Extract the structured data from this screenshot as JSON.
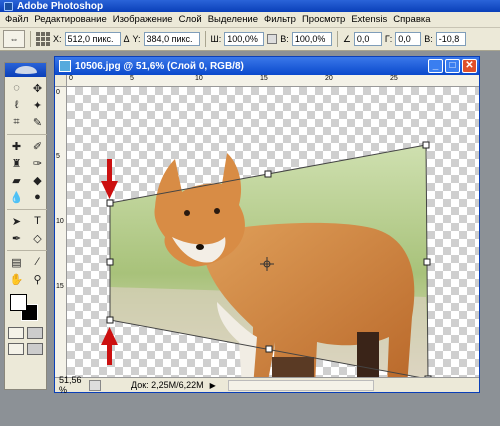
{
  "app": {
    "title": "Adobe Photoshop"
  },
  "menu": {
    "items": [
      "Файл",
      "Редактирование",
      "Изображение",
      "Слой",
      "Выделение",
      "Фильтр",
      "Просмотр",
      "Extensis",
      "Справка"
    ]
  },
  "options": {
    "x_label": "X:",
    "x_value": "512,0 пикс.",
    "delta_label": "Δ",
    "y_label": "Y:",
    "y_value": "384,0 пикс.",
    "w_label": "Ш:",
    "w_value": "100,0%",
    "h_label": "В:",
    "h_value": "100,0%",
    "angle_value": "0,0",
    "g_label": "Г:",
    "g_value": "0,0",
    "v_label": "В:",
    "v_value": "-10,8"
  },
  "document": {
    "title": "10506.jpg @ 51,6% (Слой 0, RGB/8)",
    "zoom": "51,56 %",
    "doc_size": "Док: 2,25М/6,22М",
    "ruler_h": [
      "0",
      "5",
      "10",
      "15",
      "20",
      "25"
    ],
    "ruler_v": [
      "0",
      "5",
      "10",
      "15"
    ]
  },
  "colors": {
    "accent_arrow": "#cc1010",
    "title_blue": "#0a49cc"
  }
}
